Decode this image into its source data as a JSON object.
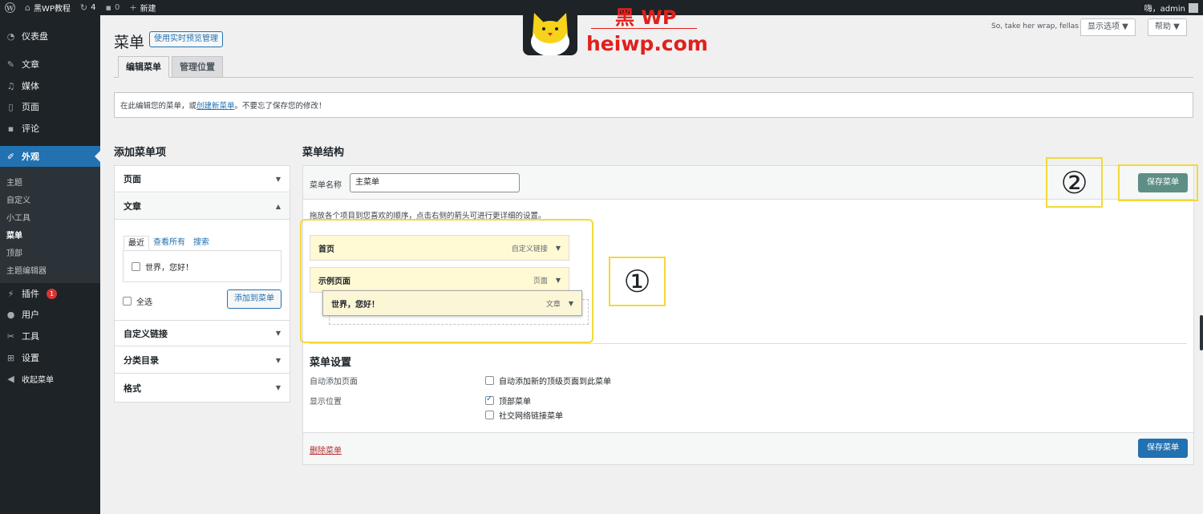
{
  "admin_bar": {
    "site_name": "黑WP教程",
    "updates_count": "4",
    "comments_count": "0",
    "new_label": "新建",
    "greeting": "嗨，admin"
  },
  "sidebar": {
    "items": [
      {
        "label": "仪表盘",
        "icon": "dashboard-icon",
        "glyph": "◔"
      },
      {
        "label": "文章",
        "icon": "pushpin-icon",
        "glyph": "✎"
      },
      {
        "label": "媒体",
        "icon": "media-icon",
        "glyph": "♫"
      },
      {
        "label": "页面",
        "icon": "page-icon",
        "glyph": "▯"
      },
      {
        "label": "评论",
        "icon": "comment-icon",
        "glyph": "▪"
      },
      {
        "label": "外观",
        "icon": "brush-icon",
        "glyph": "✐"
      }
    ],
    "submenu": [
      "主题",
      "自定义",
      "小工具",
      "菜单",
      "顶部",
      "主题编辑器"
    ],
    "lower_items": [
      {
        "label": "插件",
        "icon": "plugin-icon",
        "glyph": "⚡",
        "badge": "1"
      },
      {
        "label": "用户",
        "icon": "user-icon",
        "glyph": "●"
      },
      {
        "label": "工具",
        "icon": "wrench-icon",
        "glyph": "✂"
      },
      {
        "label": "设置",
        "icon": "settings-icon",
        "glyph": "⊞"
      },
      {
        "label": "收起菜单",
        "icon": "collapse-icon",
        "glyph": "◀"
      }
    ]
  },
  "header": {
    "title": "菜单",
    "live_preview_label": "使用实时预览管理",
    "tagline": "So, take her wrap, fellas",
    "screen_options_label": "显示选项 ▼",
    "help_label": "帮助 ▼",
    "tabs": [
      "编辑菜单",
      "管理位置"
    ]
  },
  "notice": {
    "before": "在此编辑您的菜单，或",
    "link": "创建新菜单",
    "after": "。不要忘了保存您的修改！"
  },
  "add_items": {
    "heading": "添加菜单项",
    "sections": [
      "页面",
      "文章",
      "自定义链接",
      "分类目录",
      "格式"
    ],
    "posts_tabs": [
      "最近",
      "查看所有",
      "搜索"
    ],
    "post_option": "世界，您好！",
    "select_all": "全选",
    "add_button": "添加到菜单"
  },
  "structure": {
    "heading": "菜单结构",
    "name_label": "菜单名称",
    "name_value": "主菜单",
    "save_label": "保存菜单",
    "instructions": "拖放各个项目到您喜欢的顺序，点击右侧的箭头可进行更详细的设置。",
    "items": [
      {
        "title": "首页",
        "type": "自定义链接"
      },
      {
        "title": "示例页面",
        "type": "页面"
      },
      {
        "title": "世界，您好！",
        "type": "文章"
      }
    ]
  },
  "settings": {
    "heading": "菜单设置",
    "auto_add_label": "自动添加页面",
    "auto_add_option": "自动添加新的顶级页面到此菜单",
    "location_label": "显示位置",
    "locations": [
      {
        "label": "顶部菜单",
        "checked": true
      },
      {
        "label": "社交网络链接菜单",
        "checked": false
      }
    ]
  },
  "footer": {
    "delete_label": "删除菜单",
    "save_label": "保存菜单"
  },
  "annotations": {
    "marker_1": "①",
    "marker_2": "②"
  },
  "watermark": {
    "title": "黑 WP",
    "url": "heiwp.com"
  }
}
